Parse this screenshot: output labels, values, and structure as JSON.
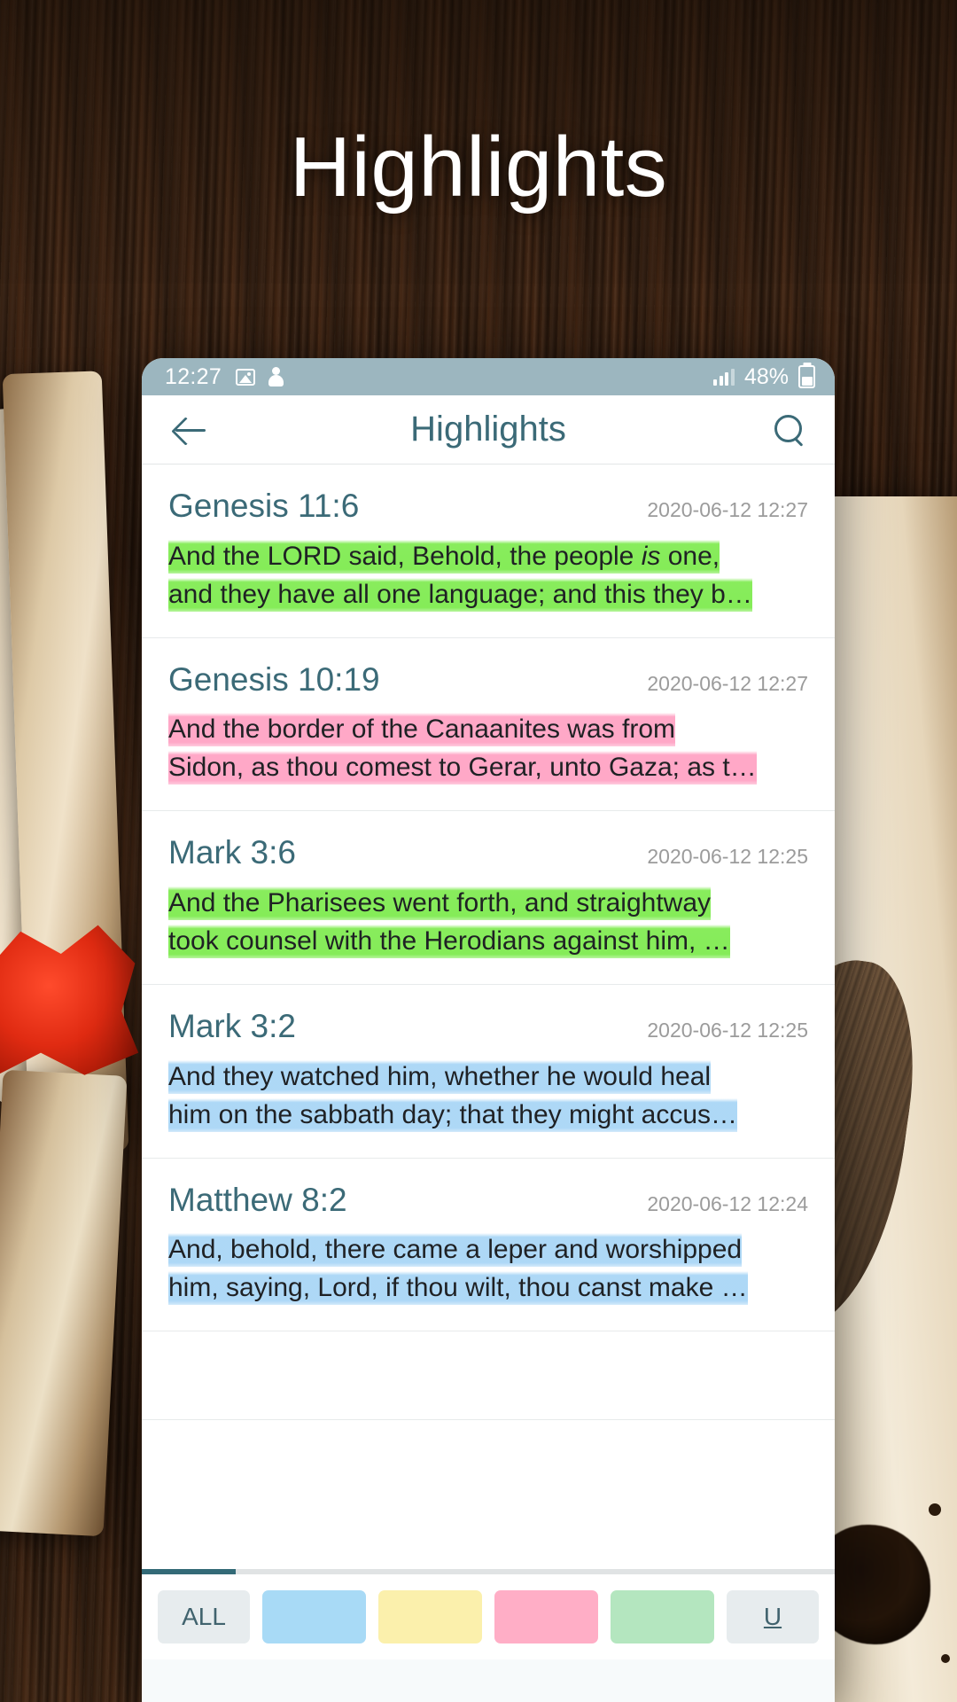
{
  "hero": {
    "title": "Highlights"
  },
  "phone": {
    "statusbar": {
      "time": "12:27",
      "battery_percent": "48%",
      "icons": [
        "image-icon",
        "person-icon",
        "signal-icon",
        "battery-icon"
      ]
    },
    "appbar": {
      "title": "Highlights",
      "back_icon": "back-arrow-icon",
      "search_icon": "search-icon"
    },
    "highlights": [
      {
        "reference": "Genesis 11:6",
        "date": "2020-06-12 12:27",
        "color": "green",
        "color_hex": "#7eeb4f",
        "line1_pre": "And the LORD said, Behold, the people ",
        "line1_em": "is",
        "line1_post": " one,",
        "line2": "and they have all one language; and this they b…"
      },
      {
        "reference": "Genesis 10:19",
        "date": "2020-06-12 12:27",
        "color": "pink",
        "color_hex": "#ffa3c4",
        "line1_pre": "And the border of the Canaanites was from",
        "line1_em": "",
        "line1_post": "",
        "line2": "Sidon, as thou comest to Gerar, unto Gaza; as t…"
      },
      {
        "reference": "Mark 3:6",
        "date": "2020-06-12 12:25",
        "color": "green",
        "color_hex": "#7eeb4f",
        "line1_pre": "And the Pharisees went forth, and straightway",
        "line1_em": "",
        "line1_post": "",
        "line2": "took counsel with the Herodians against him, …"
      },
      {
        "reference": "Mark 3:2",
        "date": "2020-06-12 12:25",
        "color": "blue",
        "color_hex": "#a9d6f6",
        "line1_pre": "And they watched him, whether he would heal",
        "line1_em": "",
        "line1_post": "",
        "line2": "him on the sabbath day; that they might accus…"
      },
      {
        "reference": "Matthew 8:2",
        "date": "2020-06-12 12:24",
        "color": "blue",
        "color_hex": "#a9d6f6",
        "line1_pre": "And, behold, there came a leper and worshipped",
        "line1_em": "",
        "line1_post": "",
        "line2": "him, saying, Lord, if thou wilt, thou canst make …"
      }
    ],
    "filterbar": {
      "all_label": "ALL",
      "underline_label": "U",
      "swatches": [
        {
          "name": "blue",
          "hex": "#a8daf6"
        },
        {
          "name": "yellow",
          "hex": "#fbf0ac"
        },
        {
          "name": "pink",
          "hex": "#ffaec6"
        },
        {
          "name": "green",
          "hex": "#b4e6bf"
        }
      ]
    },
    "theme": {
      "accent_teal": "#3b6a77",
      "statusbar_bg": "#9cb6bf",
      "scroll_thumb": "#336a77"
    }
  }
}
